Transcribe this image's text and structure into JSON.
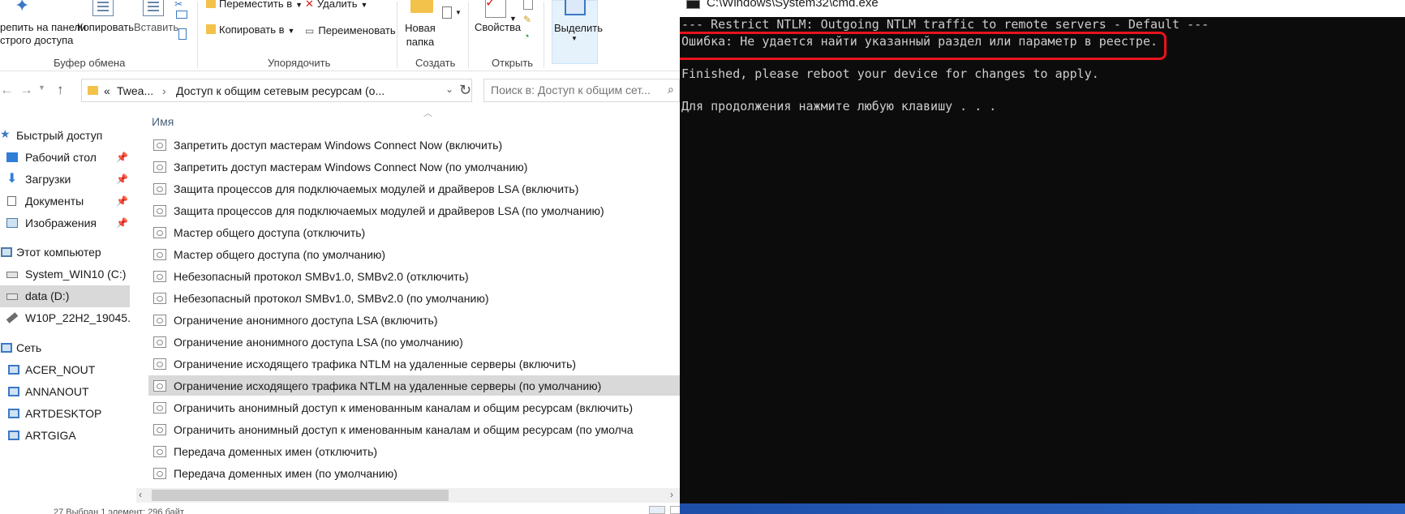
{
  "ribbon": {
    "clipboard": {
      "pin_label_line1": "репить на панели",
      "pin_label_line2": "строго доступа",
      "copy_label": "Копировать",
      "paste_label": "Вставить",
      "group_label": "Буфер обмена"
    },
    "organize": {
      "move_label": "Переместить в",
      "copy_to_label": "Копировать в",
      "delete_label": "Удалить",
      "rename_label": "Переименовать",
      "group_label": "Упорядочить"
    },
    "new": {
      "new_folder_line1": "Новая",
      "new_folder_line2": "папка",
      "group_label": "Создать"
    },
    "open": {
      "properties_label": "Свойства",
      "group_label": "Открыть"
    },
    "select": {
      "select_label": "Выделить"
    }
  },
  "address": {
    "chevrons": "«",
    "crumb1": "Twea...",
    "crumb2": "Доступ к общим сетевым ресурсам (о...",
    "search_placeholder": "Поиск в: Доступ к общим сет..."
  },
  "nav": {
    "quick_access": "Быстрый доступ",
    "desktop": "Рабочий стол",
    "downloads": "Загрузки",
    "documents": "Документы",
    "pictures": "Изображения",
    "this_pc": "Этот компьютер",
    "drive_c": "System_WIN10 (C:)",
    "drive_d": "data (D:)",
    "usb": "W10P_22H2_19045.",
    "network": "Сеть",
    "net1": "ACER_NOUT",
    "net2": "ANNANOUT",
    "net3": "ARTDESKTOP",
    "net4": "ARTGIGA"
  },
  "files": {
    "column_name": "Имя",
    "items": [
      "Запретить доступ мастерам Windows Connect Now (включить)",
      "Запретить доступ мастерам Windows Connect Now (по умолчанию)",
      "Защита процессов для подключаемых модулей и драйверов LSA (включить)",
      "Защита процессов для подключаемых модулей и драйверов LSA (по умолчанию)",
      "Мастер общего доступа (отключить)",
      "Мастер общего доступа (по умолчанию)",
      "Небезопасный протокол SMBv1.0, SMBv2.0 (отключить)",
      "Небезопасный протокол SMBv1.0, SMBv2.0 (по умолчанию)",
      "Ограничение анонимного доступа LSA (включить)",
      "Ограничение анонимного доступа LSA (по умолчанию)",
      "Ограничение исходящего трафика NTLM на удаленные серверы (включить)",
      "Ограничение исходящего трафика NTLM на удаленные серверы (по умолчанию)",
      "Ограничить анонимный доступ к именованным каналам и общим ресурсам (включить)",
      "Ограничить анонимный доступ к именованным каналам и общим ресурсам (по умолча",
      "Передача доменных имен (отключить)",
      "Передача доменных имен (по умолчанию)"
    ],
    "selected_index": 11
  },
  "status": {
    "text": "27     Выбран 1 элемент: 296 байт"
  },
  "cmd": {
    "title": "C:\\Windows\\System32\\cmd.exe",
    "line1": "--- Restrict NTLM: Outgoing NTLM traffic to remote servers - Default ---",
    "line2": "Ошибка: Не удается найти указанный раздел или параметр в реестре.",
    "line3": "Finished, please reboot your device for changes to apply.",
    "line4": "Для продолжения нажмите любую клавишу . . ."
  },
  "colors": {
    "cmd_background": "#0c0c0c",
    "cmd_text": "#cccccc",
    "highlight": "#e8131c",
    "selection": "#d9d9d9"
  }
}
